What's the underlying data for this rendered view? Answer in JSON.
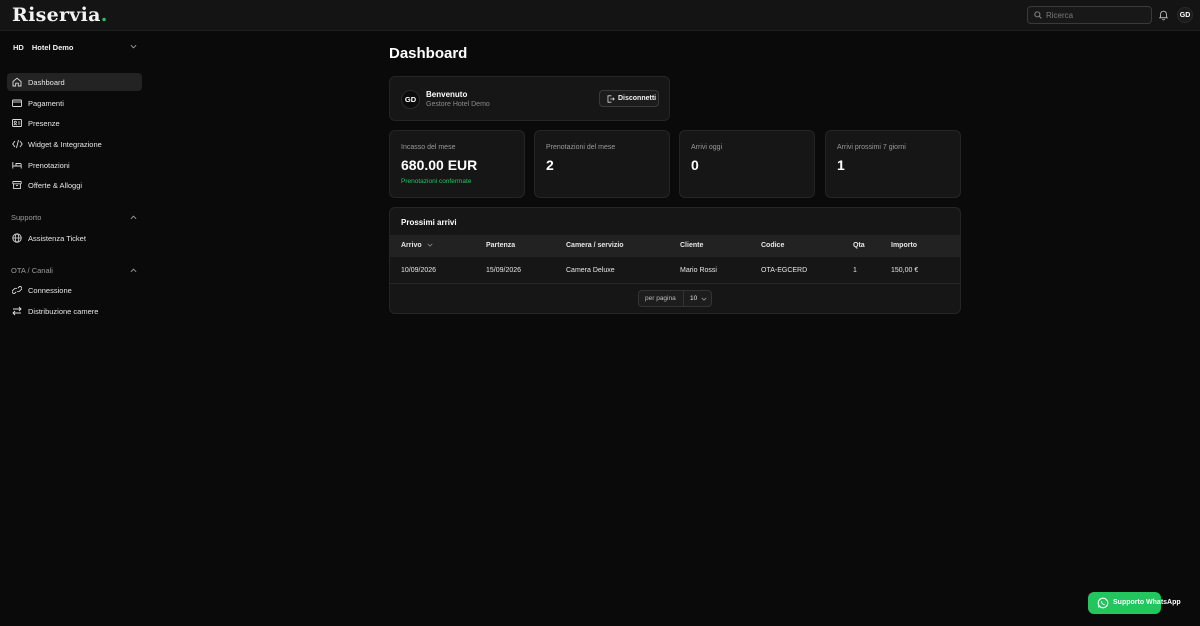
{
  "app": {
    "logo_text": "Riservia",
    "logo_dot": ".",
    "search_placeholder": "Ricerca",
    "user_initials": "GD"
  },
  "sidebar": {
    "hotel_initials": "HD",
    "hotel_name": "Hotel Demo",
    "main_items": [
      {
        "label": "Dashboard",
        "icon": "home-icon",
        "active": true
      },
      {
        "label": "Pagamenti",
        "icon": "card-icon"
      },
      {
        "label": "Presenze",
        "icon": "id-card-icon"
      },
      {
        "label": "Widget & Integrazione",
        "icon": "code-icon"
      },
      {
        "label": "Prenotazioni",
        "icon": "bed-icon"
      },
      {
        "label": "Offerte & Alloggi",
        "icon": "box-icon"
      }
    ],
    "support_title": "Supporto",
    "support_items": [
      {
        "label": "Assistenza Ticket",
        "icon": "globe-icon"
      }
    ],
    "ota_title": "OTA / Canali",
    "ota_items": [
      {
        "label": "Connessione",
        "icon": "link-icon"
      },
      {
        "label": "Distribuzione camere",
        "icon": "swap-icon"
      }
    ]
  },
  "main": {
    "title": "Dashboard",
    "welcome": {
      "initials": "GD",
      "title": "Benvenuto",
      "subtitle": "Gestore Hotel Demo",
      "logout_label": "Disconnetti"
    },
    "stats": [
      {
        "label": "Incasso del mese",
        "value": "680.00 EUR",
        "note": "Prenotazioni confermate"
      },
      {
        "label": "Prenotazioni del mese",
        "value": "2"
      },
      {
        "label": "Arrivi oggi",
        "value": "0"
      },
      {
        "label": "Arrivi prossimi 7 giorni",
        "value": "1"
      }
    ],
    "arrivals": {
      "title": "Prossimi arrivi",
      "columns": [
        "Arrivo",
        "Partenza",
        "Camera / servizio",
        "Cliente",
        "Codice",
        "Qta",
        "Importo"
      ],
      "rows": [
        [
          "10/09/2026",
          "15/09/2026",
          "Camera Deluxe",
          "Mario Rossi",
          "OTA-EGCERD",
          "1",
          "150,00 €"
        ]
      ],
      "per_page_label": "per pagina",
      "per_page_value": "10"
    }
  },
  "whatsapp_label": "Supporto WhatsApp",
  "colors": {
    "background": "#0a0a0a",
    "card": "#161616",
    "accent_green": "#22c55e"
  }
}
